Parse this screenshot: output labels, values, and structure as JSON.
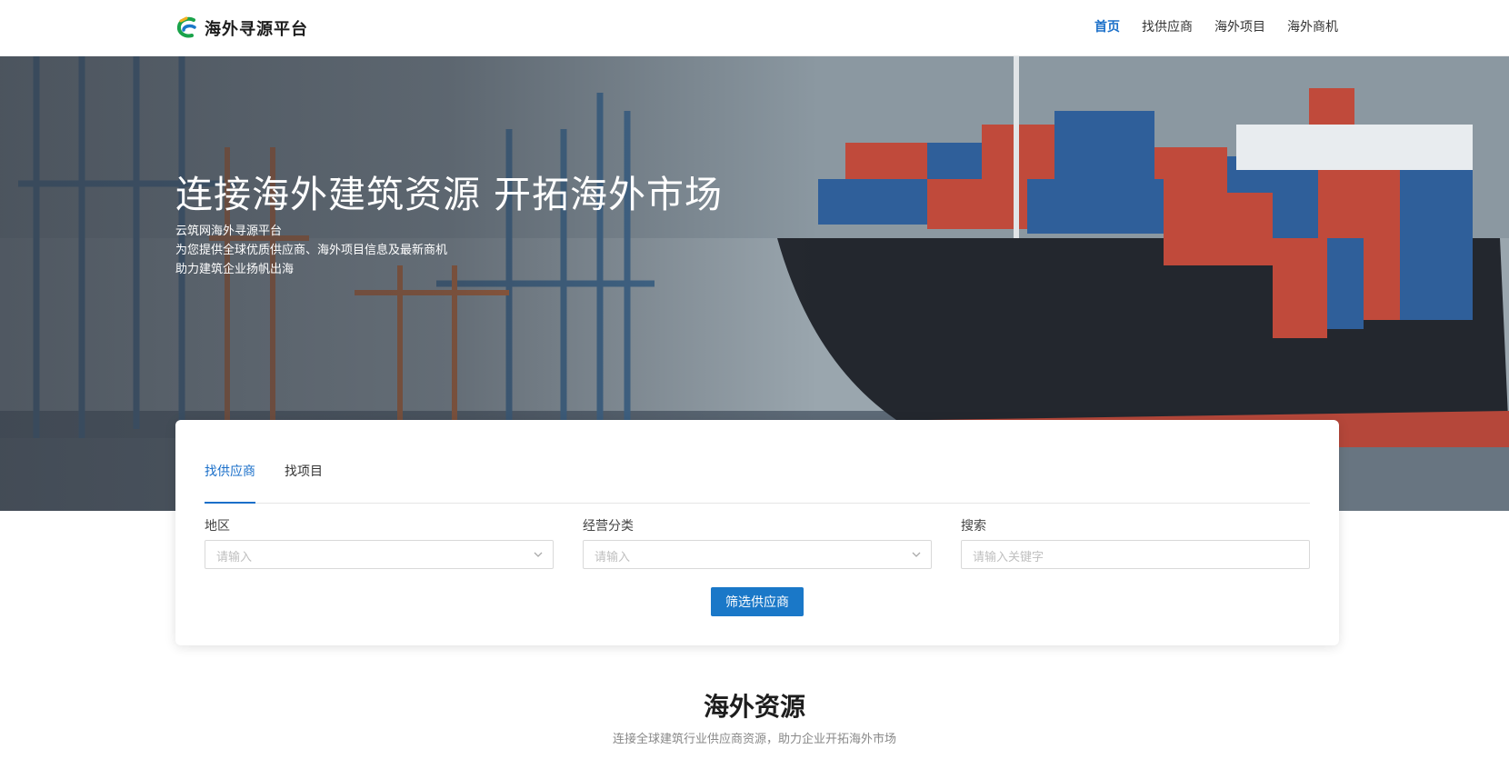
{
  "header": {
    "brand": "海外寻源平台",
    "nav": [
      {
        "label": "首页",
        "active": true
      },
      {
        "label": "找供应商",
        "active": false
      },
      {
        "label": "海外项目",
        "active": false
      },
      {
        "label": "海外商机",
        "active": false
      }
    ]
  },
  "hero": {
    "title": "连接海外建筑资源 开拓海外市场",
    "lines": [
      "云筑网海外寻源平台",
      "为您提供全球优质供应商、海外项目信息及最新商机",
      "助力建筑企业扬帆出海"
    ]
  },
  "search": {
    "tabs": [
      {
        "label": "找供应商",
        "active": true
      },
      {
        "label": "找项目",
        "active": false
      }
    ],
    "region": {
      "label": "地区",
      "placeholder": "请输入"
    },
    "category": {
      "label": "经营分类",
      "placeholder": "请输入"
    },
    "keyword": {
      "label": "搜索",
      "placeholder": "请输入关键字"
    },
    "button": "筛选供应商"
  },
  "section": {
    "title": "海外资源",
    "subtitle": "连接全球建筑行业供应商资源，助力企业开拓海外市场"
  },
  "colors": {
    "accent": "#1a6fc9",
    "button": "#1a78c8"
  }
}
